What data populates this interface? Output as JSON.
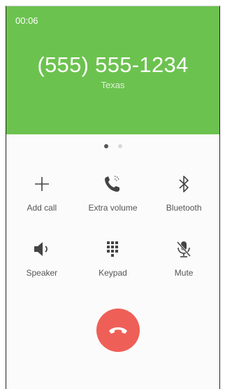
{
  "call": {
    "timer": "00:06",
    "number": "(555) 555-1234",
    "location": "Texas"
  },
  "pager": {
    "pages": 2,
    "active": 1
  },
  "buttons": {
    "add_call": {
      "label": "Add call",
      "icon": "plus-icon"
    },
    "extra_volume": {
      "label": "Extra volume",
      "icon": "phone-volume-icon"
    },
    "bluetooth": {
      "label": "Bluetooth",
      "icon": "bluetooth-icon"
    },
    "speaker": {
      "label": "Speaker",
      "icon": "speaker-icon"
    },
    "keypad": {
      "label": "Keypad",
      "icon": "keypad-icon"
    },
    "mute": {
      "label": "Mute",
      "icon": "mute-mic-icon"
    }
  },
  "end_call": {
    "icon": "end-call-icon"
  },
  "colors": {
    "header_bg": "#6cc24f",
    "end_call_bg": "#ee5f57",
    "icon": "#444444"
  }
}
